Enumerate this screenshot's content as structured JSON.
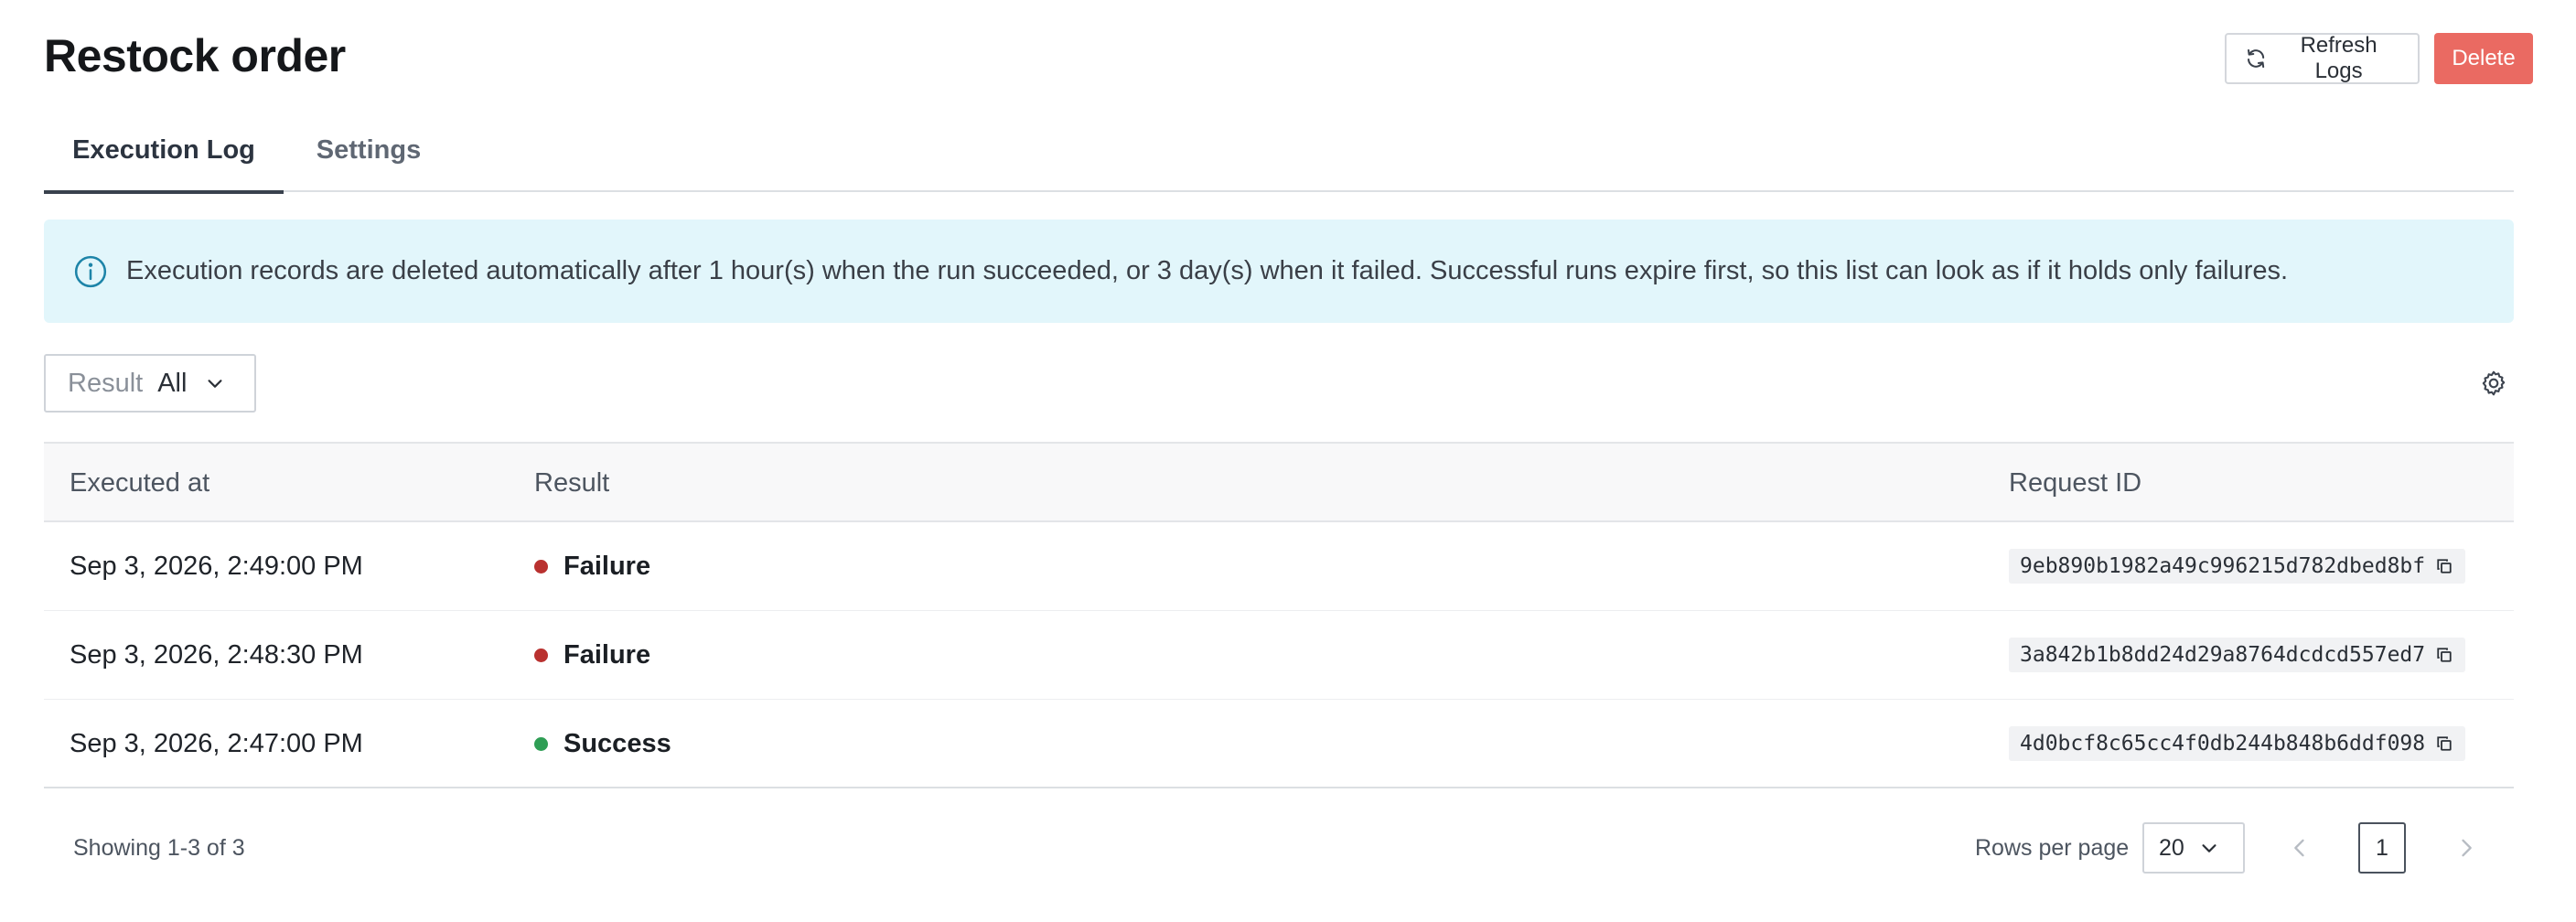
{
  "header": {
    "title": "Restock order",
    "refresh_label": "Refresh Logs",
    "delete_label": "Delete"
  },
  "tabs": [
    {
      "label": "Execution Log",
      "active": true
    },
    {
      "label": "Settings",
      "active": false
    }
  ],
  "banner": {
    "icon": "info-icon",
    "text": "Execution records are deleted automatically after 1 hour(s) when the run succeeded, or 3 day(s) when it failed. Successful runs expire first, so this list can look as if it holds only failures."
  },
  "filter": {
    "label": "Result",
    "value": "All"
  },
  "table": {
    "columns": [
      "Executed at",
      "Result",
      "Request ID"
    ],
    "rows": [
      {
        "executed_at": "Sep 3, 2026, 2:49:00 PM",
        "result": "Failure",
        "request_id": "9eb890b1982a49c996215d782dbed8bf"
      },
      {
        "executed_at": "Sep 3, 2026, 2:48:30 PM",
        "result": "Failure",
        "request_id": "3a842b1b8dd24d29a8764dcdcd557ed7"
      },
      {
        "executed_at": "Sep 3, 2026, 2:47:00 PM",
        "result": "Success",
        "request_id": "4d0bcf8c65cc4f0db244b848b6ddf098"
      }
    ]
  },
  "footer": {
    "showing": "Showing 1-3 of 3",
    "rows_per_page_label": "Rows per page",
    "rows_per_page_value": "20",
    "current_page": "1"
  },
  "colors": {
    "failure": "#b9312f",
    "success": "#2f9e55",
    "delete": "#ea6a62",
    "banner_bg": "#e2f6fb",
    "info_icon": "#1d84a8"
  }
}
